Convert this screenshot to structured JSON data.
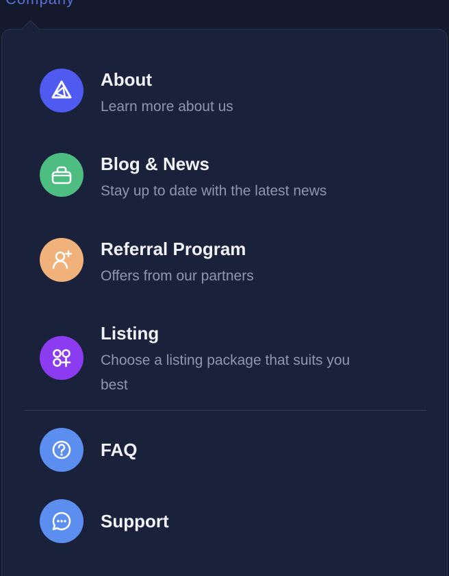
{
  "nav": {
    "top_link": "Company"
  },
  "menu": {
    "items": [
      {
        "title": "About",
        "description": "Learn more about us",
        "icon": "about-logo-icon",
        "color": "#4f5bf0"
      },
      {
        "title": "Blog & News",
        "description": "Stay up to date with the latest news",
        "icon": "briefcase-icon",
        "color": "#4dbd82"
      },
      {
        "title": "Referral Program",
        "description": "Offers from our partners",
        "icon": "user-add-icon",
        "color": "#f0b27a"
      },
      {
        "title": "Listing",
        "description": "Choose a listing package that suits you best",
        "icon": "apps-add-icon",
        "color": "#8c3cf0"
      }
    ],
    "secondary": [
      {
        "title": "FAQ",
        "icon": "question-icon",
        "color": "#5c8ef0"
      },
      {
        "title": "Support",
        "icon": "chat-icon",
        "color": "#5c8ef0"
      }
    ]
  }
}
